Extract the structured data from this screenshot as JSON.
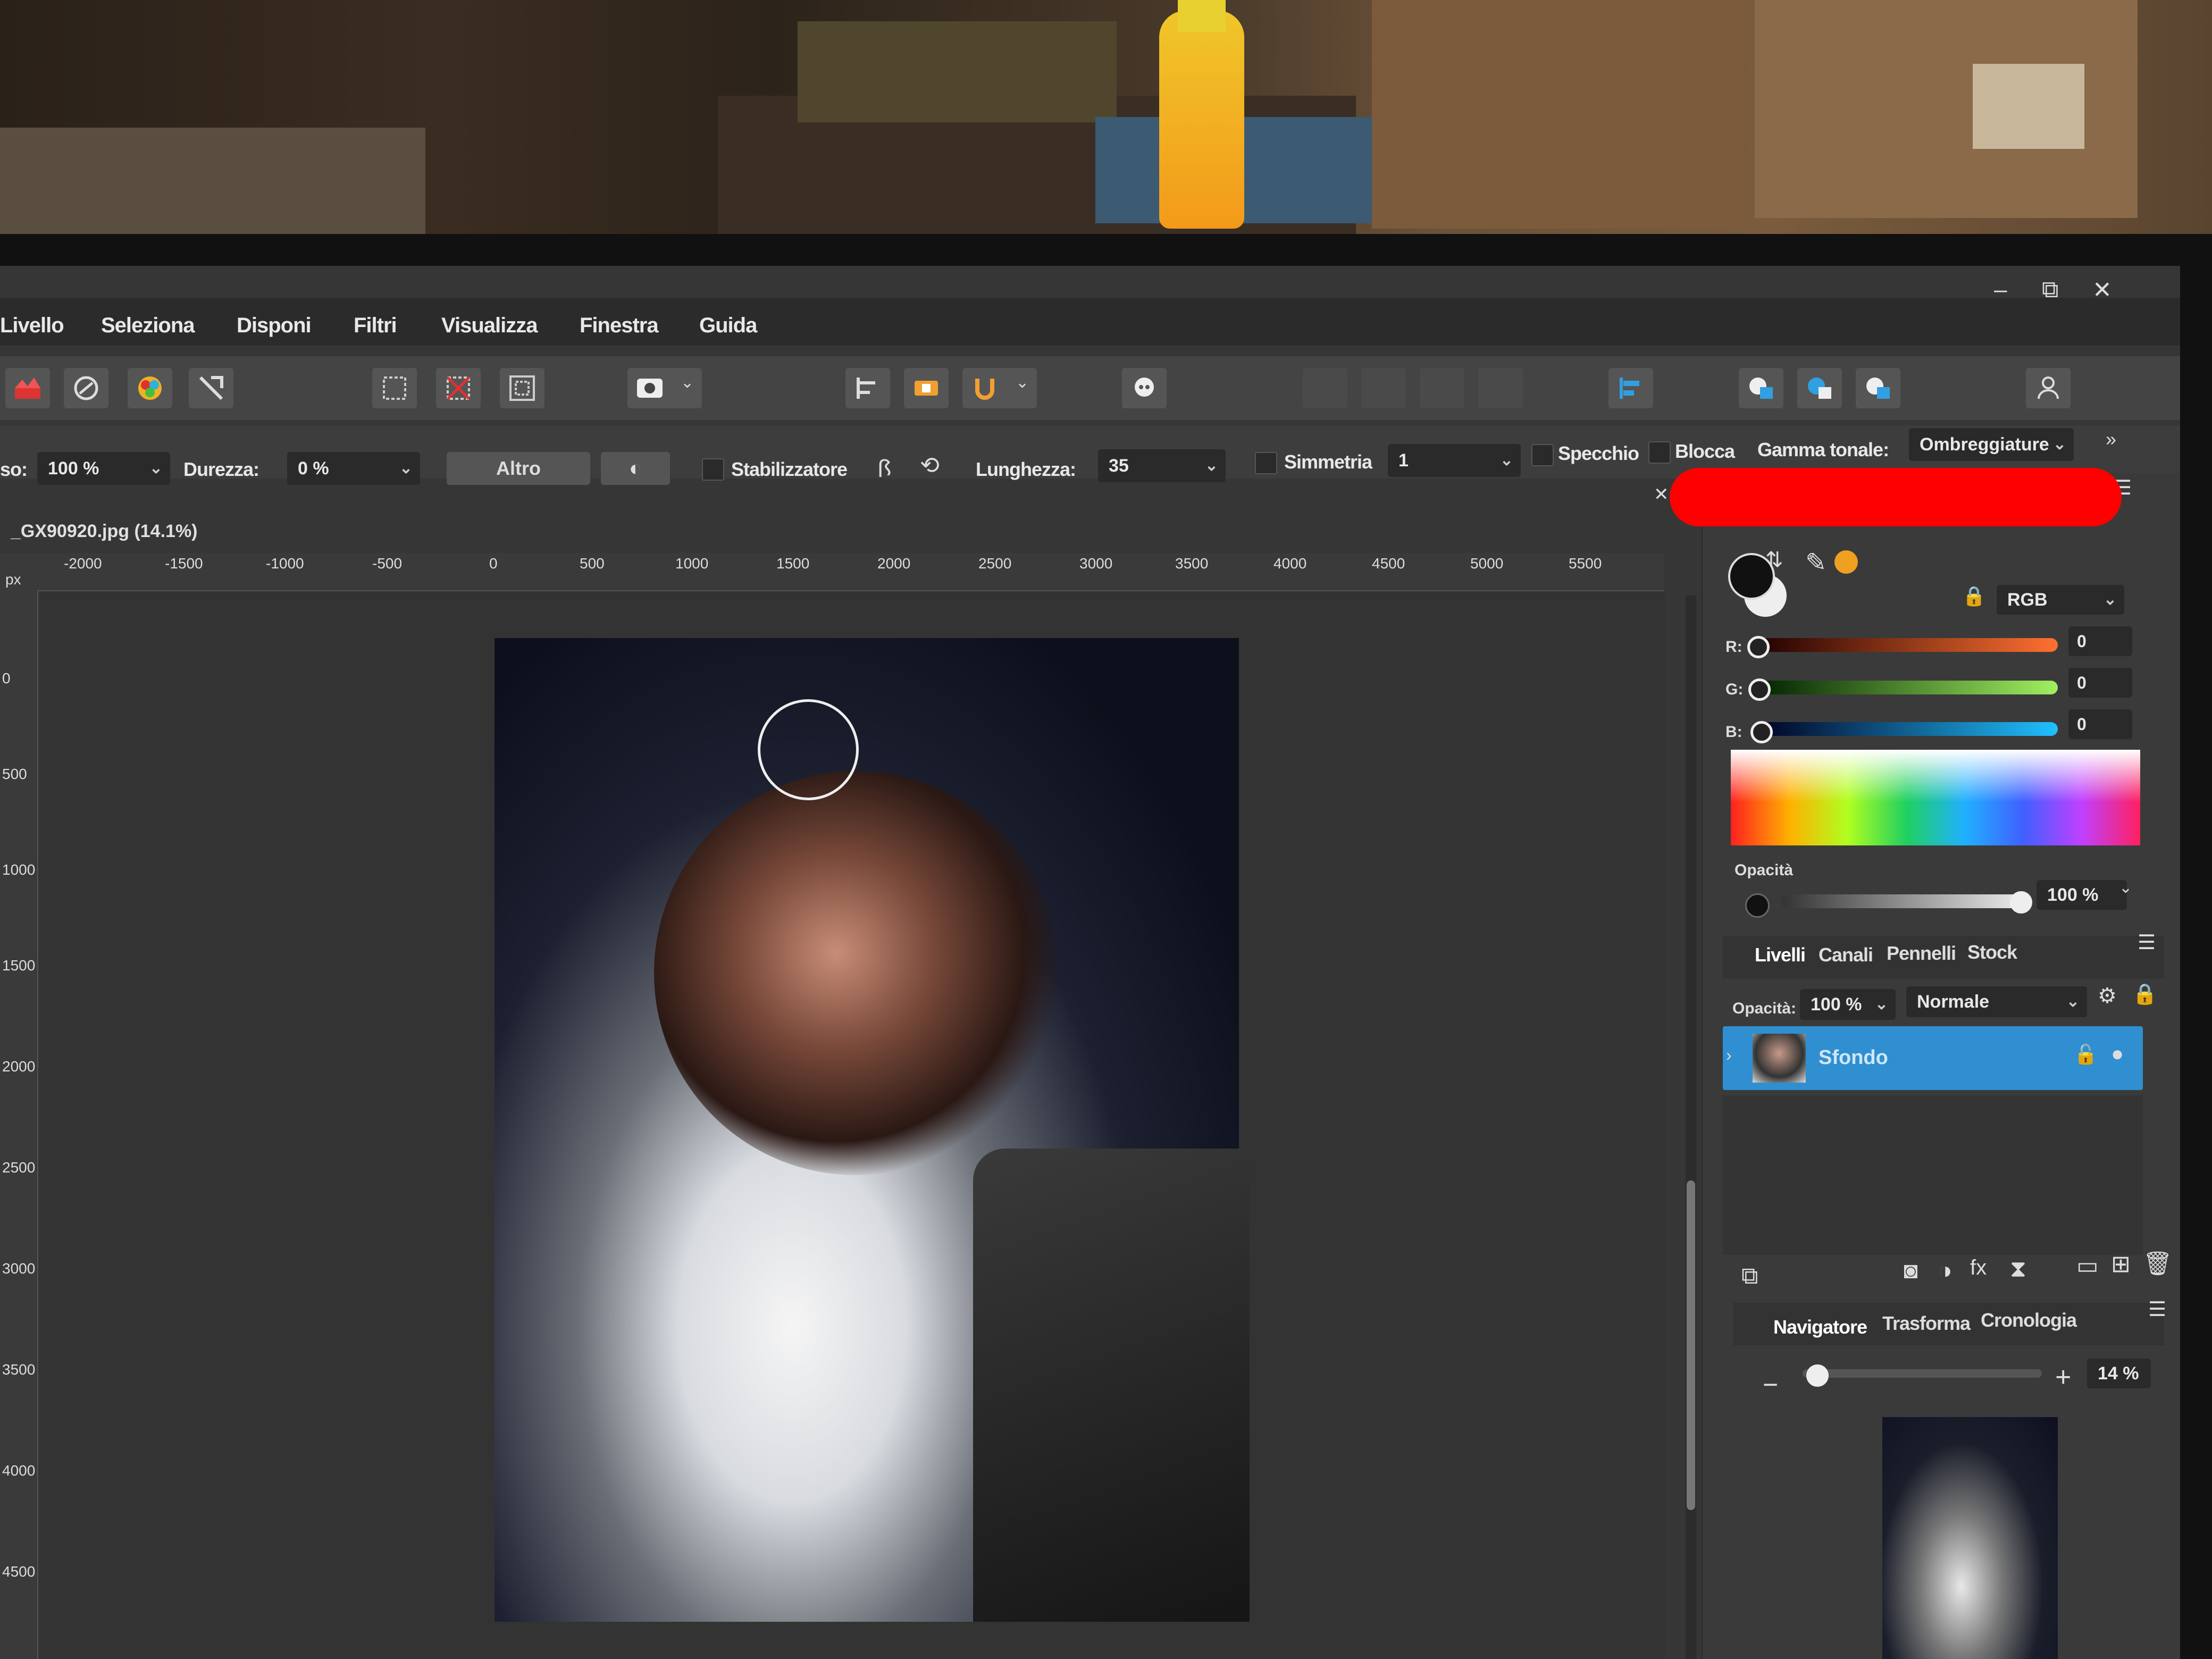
{
  "menu": {
    "items": [
      "Livello",
      "Seleziona",
      "Disponi",
      "Filtri",
      "Visualizza",
      "Finestra",
      "Guida"
    ]
  },
  "window_controls": {
    "minimize": "–",
    "maximize": "⧉",
    "close": "✕"
  },
  "context_bar": {
    "size_label": "so:",
    "size_value": "100 %",
    "hardness_label": "Durezza:",
    "hardness_value": "0 %",
    "more_button": "Altro",
    "stabilizer_label": "Stabilizzatore",
    "length_label": "Lunghezza:",
    "length_value": "35",
    "symmetry_label": "Simmetria",
    "symmetry_value": "1",
    "mirror_label": "Specchio",
    "lock_label": "Blocca",
    "tonal_range_label": "Gamma tonale:",
    "tonal_range_value": "Ombreggiature"
  },
  "document": {
    "tab_title": "_GX90920.jpg (14.1%)",
    "ruler_unit": "px",
    "ruler_h_labels": [
      "-2000",
      "-1500",
      "-1000",
      "-500",
      "0",
      "500",
      "1000",
      "1500",
      "2000",
      "2500",
      "3000",
      "3500",
      "4000",
      "4500",
      "5000",
      "5500"
    ],
    "ruler_v_labels": [
      "0",
      "500",
      "1000",
      "1500",
      "2000",
      "2500",
      "3000",
      "3500",
      "4000",
      "4500"
    ]
  },
  "color_panel": {
    "model": "RGB",
    "r_label": "R:",
    "r_value": "0",
    "g_label": "G:",
    "g_value": "0",
    "b_label": "B:",
    "b_value": "0",
    "opacity_label": "Opacità",
    "opacity_value": "100 %"
  },
  "layers_panel": {
    "tabs": [
      "Livelli",
      "Canali",
      "Pennelli",
      "Stock"
    ],
    "opacity_label": "Opacità:",
    "opacity_value": "100 %",
    "blend_mode": "Normale",
    "layers": [
      {
        "name": "Sfondo"
      }
    ]
  },
  "navigator_panel": {
    "tabs": [
      "Navigatore",
      "Trasforma",
      "Cronologia"
    ],
    "zoom_value": "14 %",
    "zoom_fraction": 0.05
  },
  "colors": {
    "accent": "#2f8fd0",
    "redaction": "#ff0000"
  }
}
